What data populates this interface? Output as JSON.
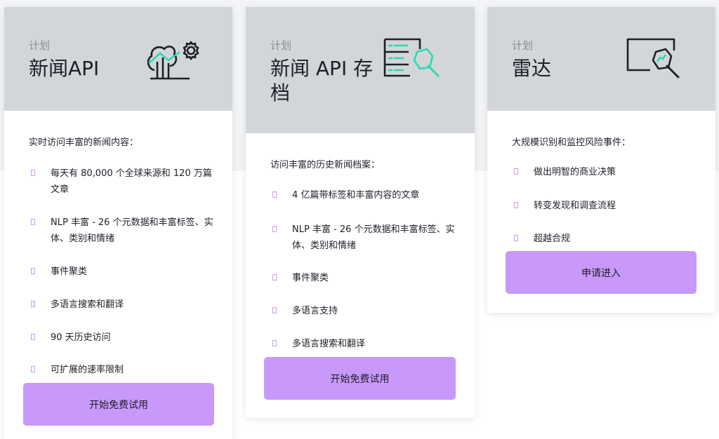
{
  "cards": [
    {
      "eyebrow": "计划",
      "title": "新闻API",
      "intro": "实时访问丰富的新闻内容：",
      "features": [
        "每天有 80,000 个全球来源和 120 万篇文章",
        "NLP 丰富 - 26 个元数据和丰富标签、实体、类别和情绪",
        "事件聚类",
        "多语言搜索和翻译",
        "90 天历史访问",
        "可扩展的速率限制"
      ],
      "cta": "开始免费试用"
    },
    {
      "eyebrow": "计划",
      "title": "新闻 API 存档",
      "intro": "访问丰富的历史新闻档案：",
      "features": [
        "4 亿篇带标签和丰富内容的文章",
        "NLP 丰富 - 26 个元数据和丰富标签、实体、类别和情绪",
        "事件聚类",
        "多语言支持",
        "多语言搜索和翻译"
      ],
      "cta": "开始免费试用"
    },
    {
      "eyebrow": "计划",
      "title": "雷达",
      "intro": "大规模识别和监控风险事件：",
      "features": [
        "做出明智的商业决策",
        "转变发现和调查流程",
        "超越合规"
      ],
      "cta": "申请进入"
    }
  ],
  "colors": {
    "header_bg": "#d3d6d9",
    "accent": "#c899fb",
    "icon_teal": "#2ed8b6",
    "icon_dark": "#1e1e28",
    "bullet": "#c79bf2"
  },
  "icons": [
    "trees-gear-icon",
    "database-magnifier-icon",
    "screen-magnifier-icon"
  ]
}
